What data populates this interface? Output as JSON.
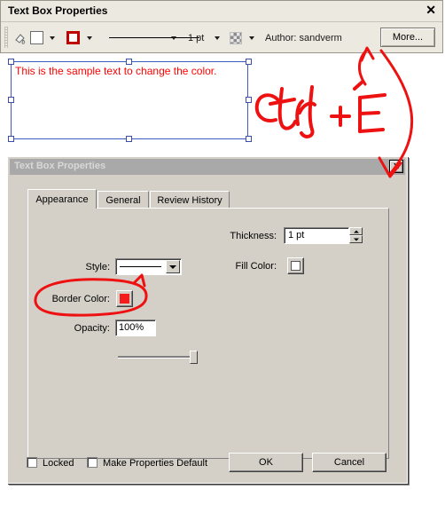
{
  "toolbar_window": {
    "title": "Text Box Properties",
    "close_icon": "close-x",
    "items": {
      "ink_icon": "ink-bottle-icon",
      "fill_swatch_label": "fill-color-white",
      "border_swatch_label": "border-color-red",
      "line_style_label": "solid-line",
      "thickness_label": "1 pt",
      "opacity_label": "checkerboard-opacity",
      "author_label": "Author: sandverm",
      "more_button": "More..."
    }
  },
  "page": {
    "textbox_text": "This is the sample text to change the color."
  },
  "dialog": {
    "title": "Text Box Properties",
    "close_icon": "close-x",
    "tabs": [
      {
        "label": "Appearance",
        "active": true
      },
      {
        "label": "General",
        "active": false
      },
      {
        "label": "Review History",
        "active": false
      }
    ],
    "fields": {
      "thickness_label": "Thickness:",
      "thickness_value": "1 pt",
      "fill_color_label": "Fill Color:",
      "fill_color_value": "#ffffff",
      "style_label": "Style:",
      "style_value": "solid-line",
      "border_color_label": "Border Color:",
      "border_color_value": "#f41c1c",
      "opacity_label": "Opacity:",
      "opacity_value": "100%",
      "opacity_slider_percent": 100
    },
    "footer": {
      "locked_label": "Locked",
      "locked_checked": false,
      "make_default_label": "Make Properties Default",
      "make_default_checked": false,
      "ok_label": "OK",
      "cancel_label": "Cancel"
    }
  },
  "annotations": {
    "shortcut_text": "ctrl + E",
    "ink_color": "#ee1111",
    "notes": [
      "arrow pointing up to More... button",
      "arrow curving down to Text Box Properties dialog",
      "ellipse circling Border Color row"
    ]
  }
}
